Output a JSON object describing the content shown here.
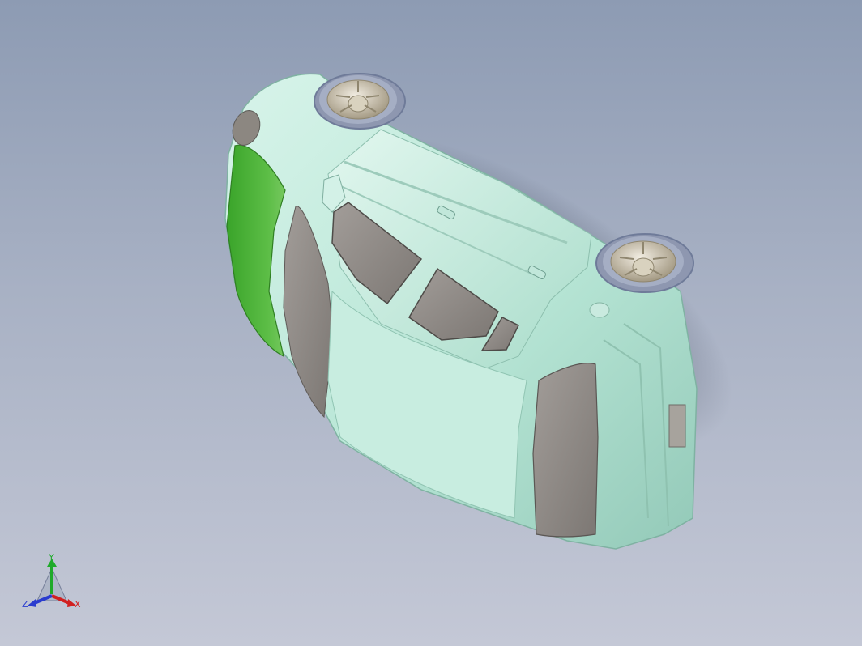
{
  "viewport": {
    "background_top": "#8d9bb3",
    "background_bottom": "#c4c8d6"
  },
  "model": {
    "body_color": "#b8e6d6",
    "body_highlight": "#d8f4ea",
    "body_shade": "#93c9b8",
    "selected_face_color": "#4fb23a",
    "glass_color": "#8f8a86",
    "wheel_rim_color": "#c9c1ad",
    "tire_color": "#a5aec4",
    "tire_edge": "#6f7b99"
  },
  "triad": {
    "y_label": "Y",
    "z_label": "Z",
    "x_label": "X",
    "y_color": "#1faa2a",
    "x_color": "#d12020",
    "z_color": "#2a3ccf"
  }
}
